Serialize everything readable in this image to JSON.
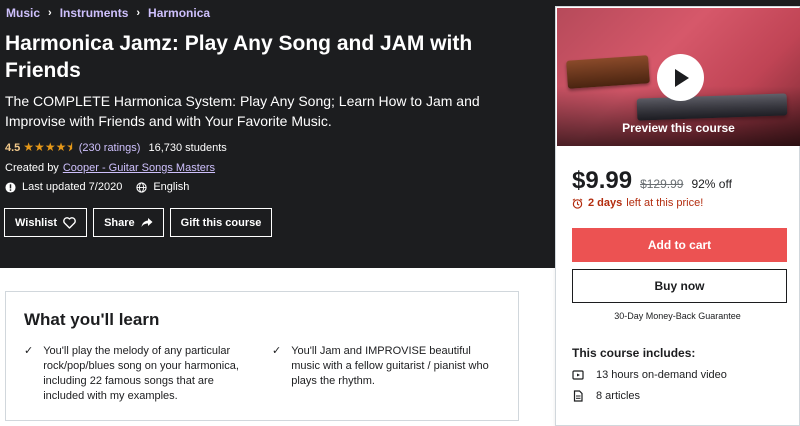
{
  "breadcrumb": [
    "Music",
    "Instruments",
    "Harmonica"
  ],
  "course": {
    "title": "Harmonica Jamz: Play Any Song and JAM with Friends",
    "subtitle": "The COMPLETE Harmonica System: Play Any Song; Learn How to Jam and Improvise with Friends and with Your Favorite Music.",
    "rating": "4.5",
    "ratings_count": "(230 ratings)",
    "students": "16,730 students",
    "created_by_label": "Created by",
    "author": "Cooper - Guitar Songs Masters",
    "last_updated": "Last updated 7/2020",
    "language": "English"
  },
  "actions": {
    "wishlist": "Wishlist",
    "share": "Share",
    "gift": "Gift this course"
  },
  "sidebar": {
    "preview_label": "Preview this course",
    "price": "$9.99",
    "old_price": "$129.99",
    "discount": "92% off",
    "timer_bold": "2 days",
    "timer_text": "left at this price!",
    "add_to_cart": "Add to cart",
    "buy_now": "Buy now",
    "guarantee": "30-Day Money-Back Guarantee",
    "includes_title": "This course includes:",
    "includes": [
      "13 hours on-demand video",
      "8 articles"
    ]
  },
  "learn": {
    "title": "What you'll learn",
    "items": [
      "You'll play the melody of any particular rock/pop/blues song on your harmonica, including 22 famous songs that are included with my examples.",
      "You'll Jam and IMPROVISE beautiful music with a fellow guitarist / pianist who plays the rhythm."
    ]
  },
  "colors": {
    "hero_bg": "#1c1d1f",
    "link_purple": "#cec0fc",
    "star_orange": "#e59819",
    "cart_red": "#ec5252",
    "timer_red": "#b32d0f"
  }
}
